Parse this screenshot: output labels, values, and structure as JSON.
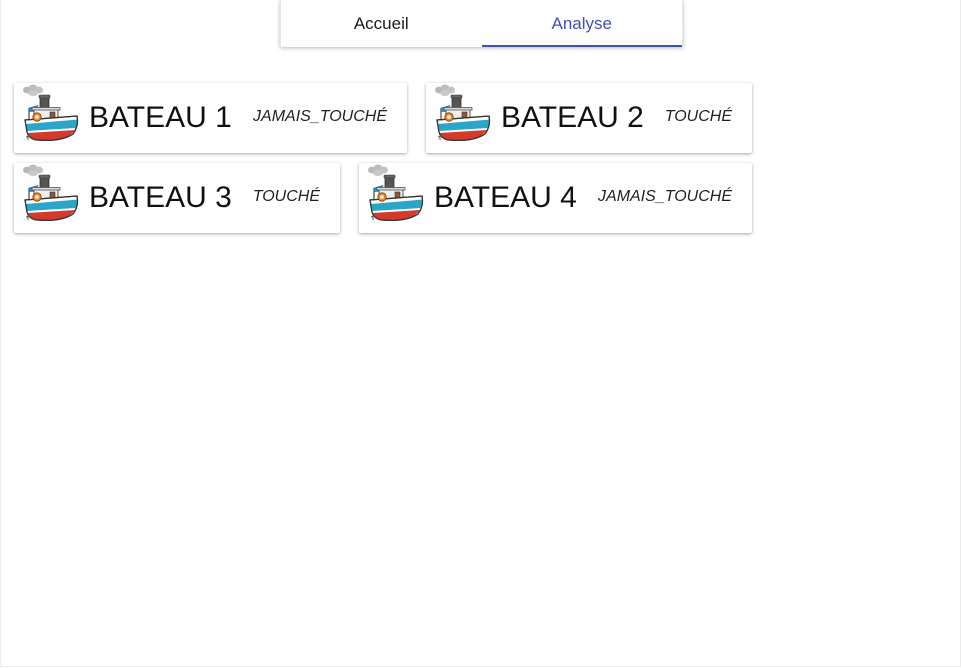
{
  "tabs": [
    {
      "label": "Accueil",
      "active": false
    },
    {
      "label": "Analyse",
      "active": true
    }
  ],
  "accent_color": "#3f51b5",
  "boats": [
    {
      "name": "BATEAU 1",
      "status": "JAMAIS_TOUCHÉ",
      "icon": "tugboat-icon"
    },
    {
      "name": "BATEAU 2",
      "status": "TOUCHÉ",
      "icon": "tugboat-icon"
    },
    {
      "name": "BATEAU 3",
      "status": "TOUCHÉ",
      "icon": "tugboat-icon"
    },
    {
      "name": "BATEAU 4",
      "status": "JAMAIS_TOUCHÉ",
      "icon": "tugboat-icon"
    }
  ]
}
